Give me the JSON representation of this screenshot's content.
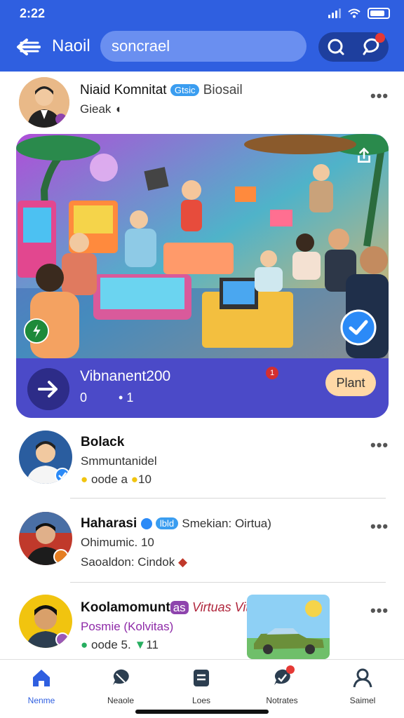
{
  "status": {
    "time": "2:22"
  },
  "header": {
    "title": "Naoil",
    "search_value": "soncrael"
  },
  "post": {
    "author": "Niaid Komnitat",
    "tag": "Gtsic",
    "extra": "Biosail",
    "meta": "Gieak"
  },
  "feature": {
    "title": "Vibnanent200",
    "stat_left": "0",
    "stat_right": "• 1",
    "badge": "1",
    "action_label": "Plant"
  },
  "feed": [
    {
      "name": "Bolack",
      "line1": "Smmuntanidel",
      "line2": "oode a",
      "line2_count": "10"
    },
    {
      "name": "Haharasi",
      "name_tag": "lbld",
      "name_extra": "Smekian: Oirtua)",
      "line1": "Ohimumic. 10",
      "line2": "Saoaldon: Cindok"
    },
    {
      "name": "Koolamomunt",
      "name_tag": "as",
      "name_extra": "Virtuas Vitual",
      "line1": "Posmie (Kolvitas)",
      "line2": "oode 5.",
      "line2_count": "11"
    }
  ],
  "nav": [
    {
      "label": "Nenme",
      "icon": "home-icon"
    },
    {
      "label": "Neaole",
      "icon": "chat-bubble-icon"
    },
    {
      "label": "Loes",
      "icon": "list-icon"
    },
    {
      "label": "Notrates",
      "icon": "notification-icon"
    },
    {
      "label": "Saimel",
      "icon": "profile-icon"
    }
  ],
  "colors": {
    "primary": "#2f5fe0",
    "card": "#4b4ac8",
    "action": "#ffd8a6"
  }
}
